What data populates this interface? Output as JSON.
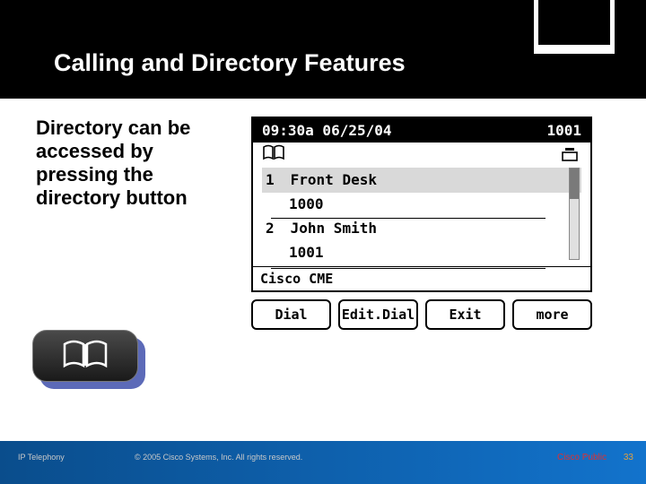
{
  "colors": {
    "accent": "#1273cc",
    "public": "#e03030",
    "page": "#e0a040"
  },
  "title": "Calling and Directory Features",
  "blurb": "Directory can be accessed by pressing the directory button",
  "dir_button": {
    "icon": "book-icon"
  },
  "phone": {
    "status": {
      "time_date": "09:30a 06/25/04",
      "extension": "1001"
    },
    "line_icon": "phone-handset-icon",
    "book_icon": "book-icon",
    "entries": [
      {
        "index": "1",
        "name": "Front Desk",
        "number": "1000",
        "selected": true
      },
      {
        "index": "2",
        "name": "John Smith",
        "number": "1001",
        "selected": false
      }
    ],
    "prompt": "Cisco CME",
    "softkeys": [
      "Dial",
      "Edit.Dial",
      "Exit",
      "more"
    ]
  },
  "footer": {
    "left": "IP Telephony",
    "mid": "© 2005 Cisco Systems, Inc. All rights reserved.",
    "right": "Cisco Public",
    "page": "33"
  }
}
